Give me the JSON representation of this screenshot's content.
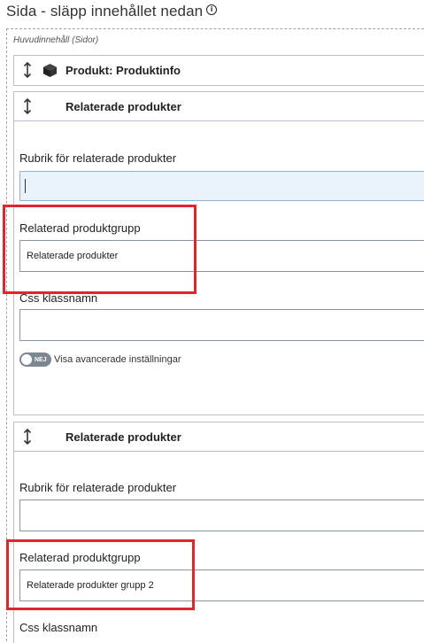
{
  "page": {
    "title": "Sida - släpp innehållet nedan",
    "info_icon": "info-circle-icon"
  },
  "zone": {
    "label": "Huvudinnehåll (Sidor)"
  },
  "modules": [
    {
      "title": "Produkt: Produktinfo",
      "icon": "cube-icon"
    },
    {
      "title": "Relaterade produkter",
      "heading_label": "Rubrik för relaterade produkter",
      "heading_value": "",
      "group_label": "Relaterad produktgrupp",
      "group_value": "Relaterade produkter",
      "css_label": "Css klassnamn",
      "css_value": "",
      "toggle_state": "NEJ",
      "toggle_label": "Visa avancerade inställningar"
    },
    {
      "title": "Relaterade produkter",
      "heading_label": "Rubrik för relaterade produkter",
      "heading_value": "",
      "group_label": "Relaterad produktgrupp",
      "group_value": "Relaterade produkter grupp 2",
      "css_label": "Css klassnamn"
    }
  ],
  "colors": {
    "highlight": "#e0262c",
    "focused_input_bg": "#eaf2fb",
    "toggle_off": "#7d8792"
  }
}
